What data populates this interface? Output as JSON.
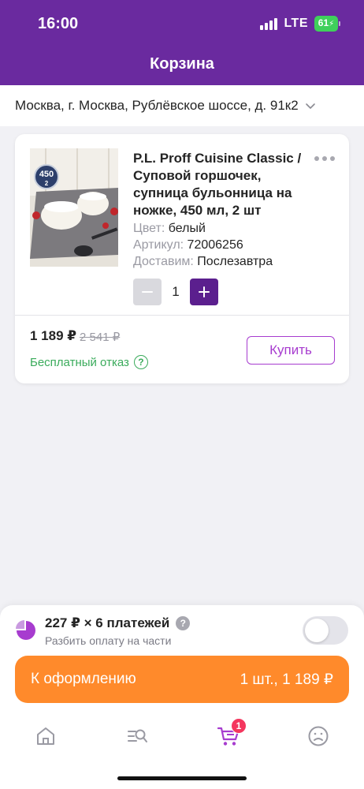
{
  "status_bar": {
    "time": "16:00",
    "network": "LTE",
    "battery": "61"
  },
  "header": {
    "title": "Корзина"
  },
  "address": {
    "text": "Москва, г. Москва, Рублёвское шоссе, д. 91к2"
  },
  "product": {
    "title": "P.L. Proff Cuisine Classic / Суповой горшочек, супница бульонница на ножке, 450 мл, 2 шт",
    "image_badge": "450",
    "image_badge_sub": "2",
    "color_label": "Цвет:",
    "color_value": "белый",
    "article_label": "Артикул:",
    "article_value": "72006256",
    "delivery_label": "Доставим:",
    "delivery_value": "Послезавтра",
    "quantity": "1",
    "price": "1 189 ₽",
    "old_price": "2 541 ₽",
    "free_refusal": "Бесплатный отказ",
    "buy_label": "Купить"
  },
  "installment": {
    "main": "227 ₽ × 6 платежей",
    "sub": "Разбить оплату на части",
    "enabled": false
  },
  "checkout": {
    "label": "К оформлению",
    "summary": "1 шт., 1 189 ₽"
  },
  "tabbar": {
    "items": [
      {
        "icon": "home-icon"
      },
      {
        "icon": "catalog-search-icon"
      },
      {
        "icon": "cart-icon",
        "badge": "1"
      },
      {
        "icon": "profile-icon"
      }
    ]
  },
  "colors": {
    "brand_purple": "#6a2a9f",
    "accent_orange": "#ff8a2b",
    "success_green": "#3aab5b",
    "badge_red": "#f4365e"
  }
}
